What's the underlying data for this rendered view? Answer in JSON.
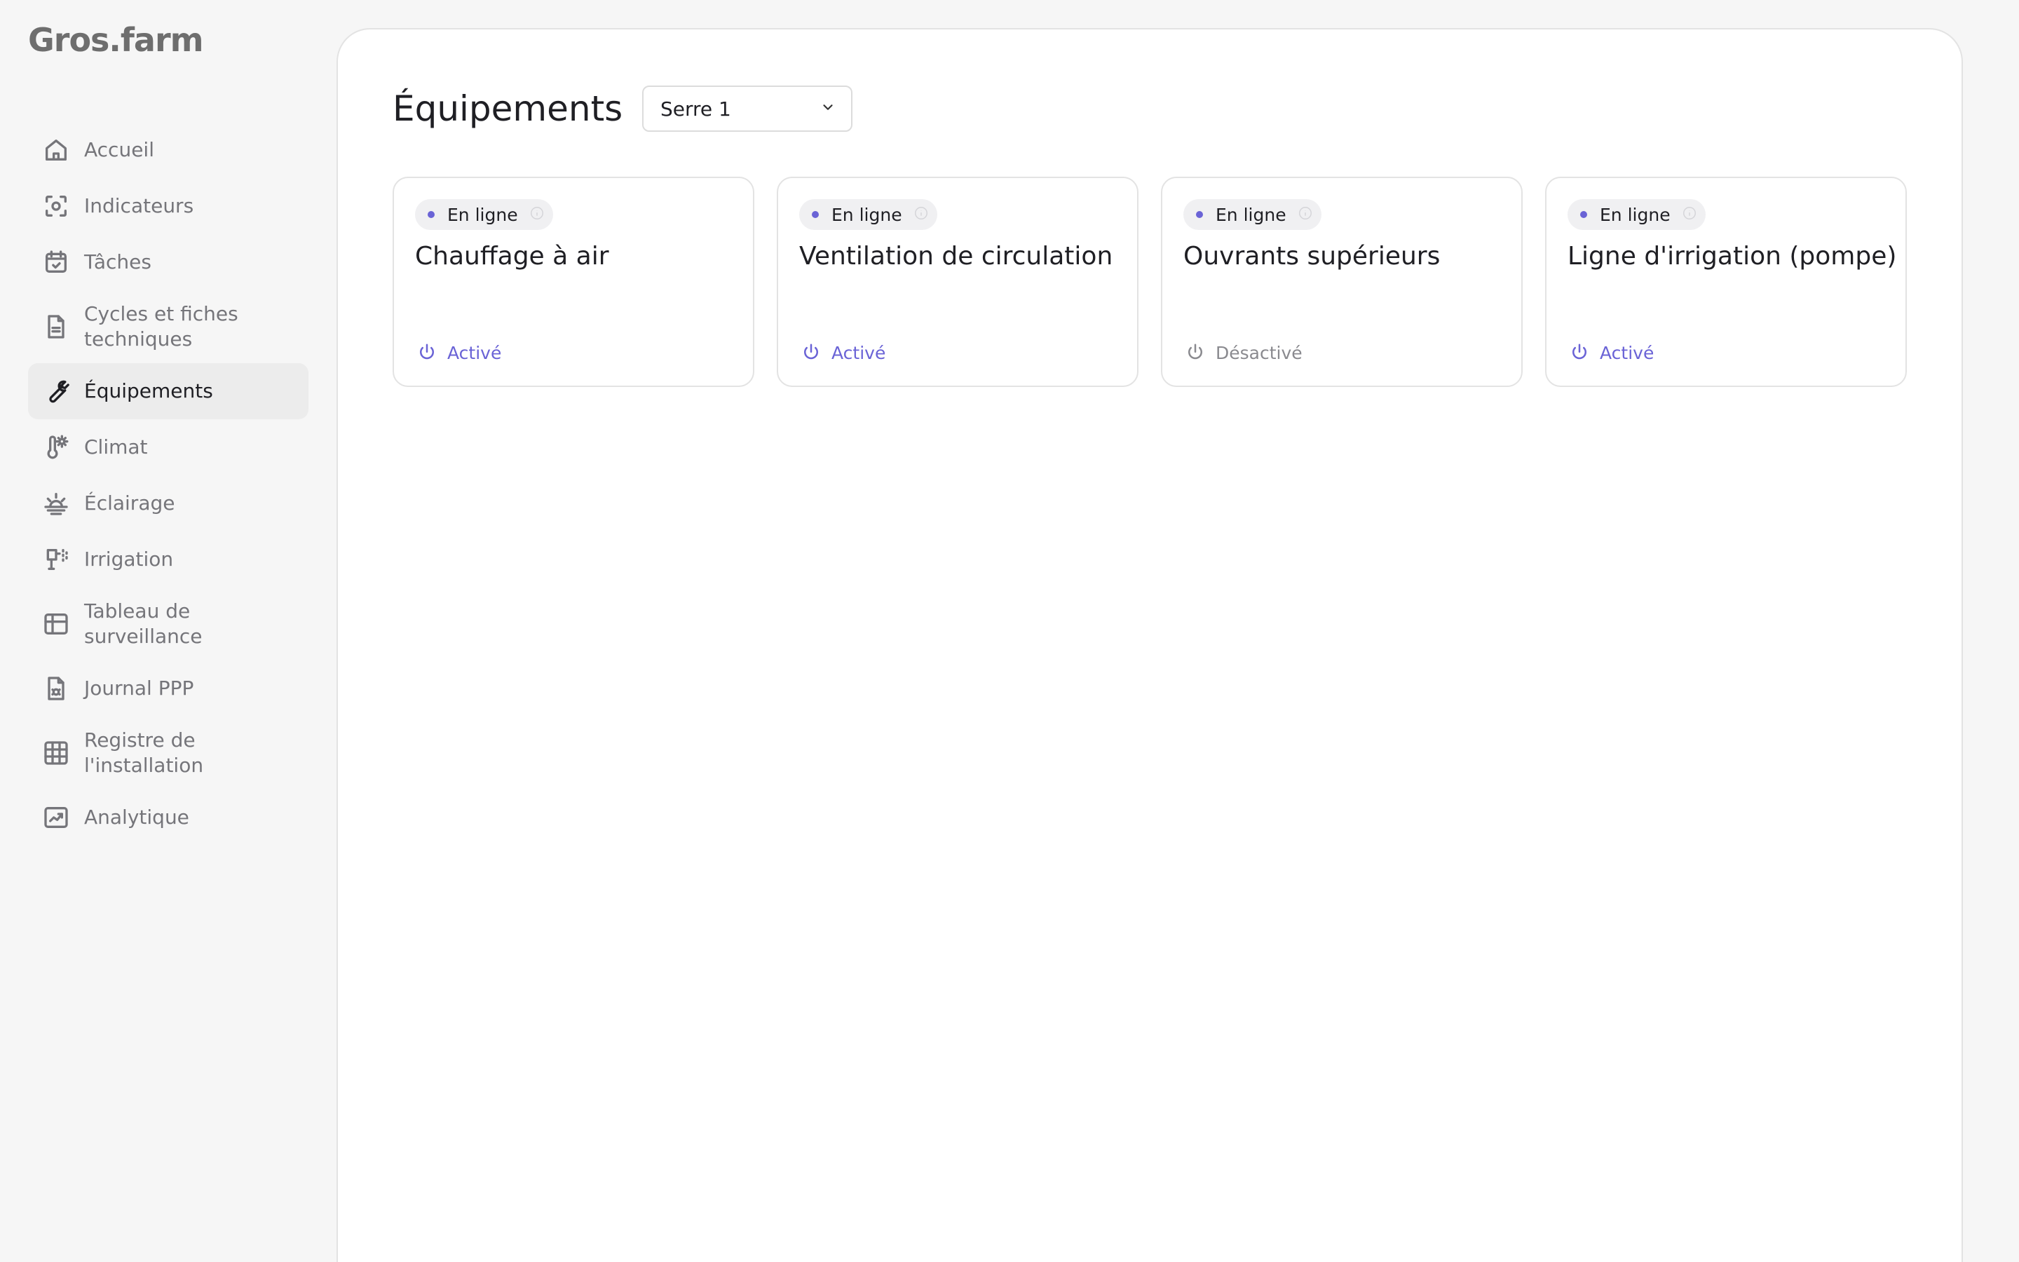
{
  "app": {
    "logo": "Gros.farm"
  },
  "sidebar": {
    "items": [
      {
        "label": "Accueil",
        "icon": "home-icon"
      },
      {
        "label": "Indicateurs",
        "icon": "sensor-icon"
      },
      {
        "label": "Tâches",
        "icon": "calendar-check-icon"
      },
      {
        "label": "Cycles et fiches techniques",
        "icon": "document-icon"
      },
      {
        "label": "Équipements",
        "icon": "wrench-icon",
        "active": true
      },
      {
        "label": "Climat",
        "icon": "thermometer-sun-icon"
      },
      {
        "label": "Éclairage",
        "icon": "sunrise-icon"
      },
      {
        "label": "Irrigation",
        "icon": "irrigation-icon"
      },
      {
        "label": "Tableau de surveillance",
        "icon": "grid-table-icon"
      },
      {
        "label": "Journal PPP",
        "icon": "bug-document-icon"
      },
      {
        "label": "Registre de l'installation",
        "icon": "grid-icon"
      },
      {
        "label": "Analytique",
        "icon": "chart-trend-icon"
      }
    ]
  },
  "main": {
    "title": "Équipements",
    "greenhouse_select": {
      "value": "Serre 1"
    },
    "cards": [
      {
        "status": "En ligne",
        "title": "Chauffage à air",
        "state": "Activé",
        "enabled": true
      },
      {
        "status": "En ligne",
        "title": "Ventilation de circulation",
        "state": "Activé",
        "enabled": true
      },
      {
        "status": "En ligne",
        "title": "Ouvrants supérieurs",
        "state": "Désactivé",
        "enabled": false
      },
      {
        "status": "En ligne",
        "title": "Ligne d'irrigation (pompe)",
        "state": "Activé",
        "enabled": true
      }
    ]
  },
  "colors": {
    "accent": "#6a63d6",
    "inactive": "#8a8a8f",
    "sidebar_bg": "#f6f6f6",
    "active_item_bg": "#ececec"
  }
}
